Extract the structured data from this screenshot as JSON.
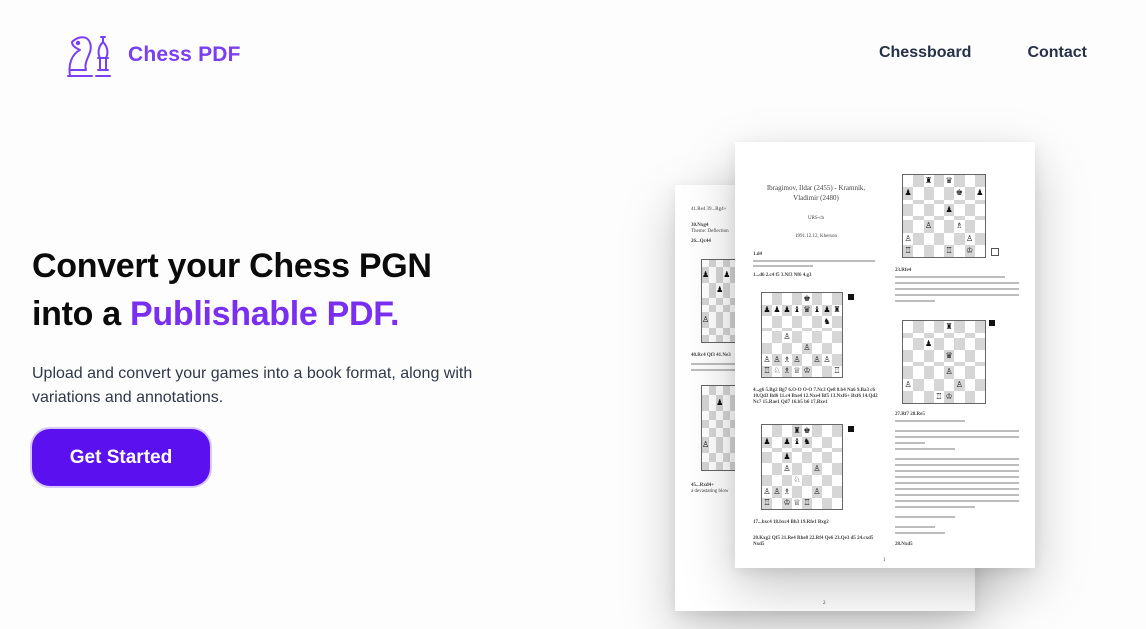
{
  "brand": {
    "name": "Chess PDF",
    "logo_icon": "chess-knight-bishop-icon",
    "color": "#7a3ff2"
  },
  "nav": {
    "items": [
      {
        "label": "Chessboard"
      },
      {
        "label": "Contact"
      }
    ]
  },
  "hero": {
    "title_line1": "Convert your Chess PGN",
    "title_line2_prefix": "into a ",
    "title_line2_accent": "Publishable PDF.",
    "subtitle": "Upload and convert your games into a book format, along with variations and annotations.",
    "cta_label": "Get Started",
    "accent_color": "#7a2ff0",
    "cta_color": "#5b10f0"
  },
  "preview": {
    "front": {
      "heading1": "Ibragimov, Ildar (2455) - Kramnik,",
      "heading2": "Vladimir (2480)",
      "event": "URS-ch",
      "date": "1991.12.12, Kherson",
      "opening": "1.d4",
      "moves_a": "1...d6 2.c4 f5 3.Nf3 Nf6 4.g3",
      "moves_b": "4...g6 5.Bg2 Bg7 6.O-O O-O 7.Nc3 Qe8 8.b4 Na6 9.Ba3 c6 10.Qd3 Bd6 11.c4 Bxe4 12.Nxe4 Bf5 13.Nxf6+ Bxf6 14.Qd2 Nc7 15.Rae1 Qd7 16.b5 b6 17.Bxe1",
      "moves_c": "17...bxc4 18.bxc4 Bh3 19.Rfe1 Bxg2",
      "moves_d": "20.Kxg2 Qf5 21.Re4 Rhe8 22.Rf4 Qe6 23.Qe3 d5 24.cxd5 Nxd5",
      "note_r1": "23.Rfe4",
      "note_r2": "27.Rf7 28.Re5",
      "note_r3": "28.Nxd5",
      "page_number": "1"
    },
    "back": {
      "line1": "41.Re4 39...Rg4+",
      "line2": "30.Nxg4",
      "line3": "Theme: Deflection",
      "line4": "26...Qc44",
      "line5": "40.Rc4 Qf3 41.Ne3",
      "line6": "45...Rxd4+",
      "line7": "a devastating blow",
      "page_number": "2"
    }
  }
}
